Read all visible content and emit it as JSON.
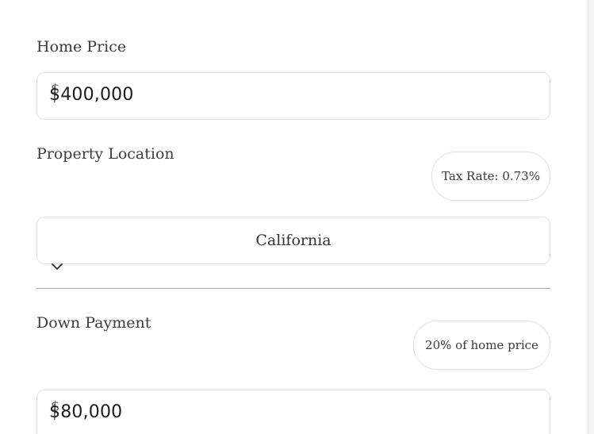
{
  "home_price": {
    "label": "Home Price",
    "currency_symbol": "$",
    "value": "$400,000"
  },
  "property_location": {
    "label": "Property Location",
    "tax_rate_badge": "Tax Rate: 0.73%",
    "selected_state": "California",
    "dropdown_icon": "chevron-down-icon"
  },
  "down_payment": {
    "label": "Down Payment",
    "percent_badge": "20% of home price",
    "currency_symbol": "$",
    "value": "$80,000"
  }
}
